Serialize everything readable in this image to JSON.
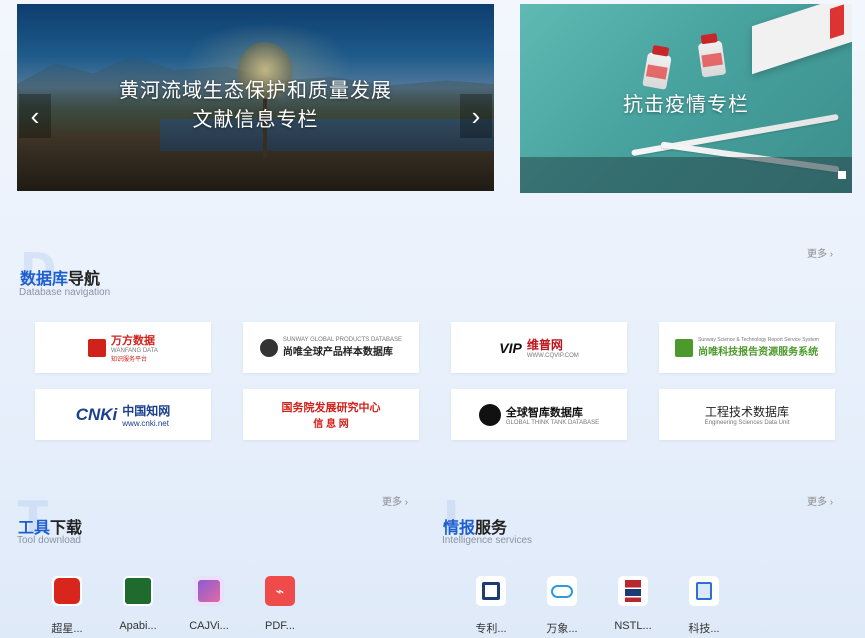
{
  "banners": {
    "left": {
      "title_line1": "黄河流域生态保护和质量发展",
      "title_line2": "文献信息专栏",
      "prev": "‹",
      "next": "›"
    },
    "right": {
      "title": "抗击疫情专栏"
    }
  },
  "database_nav": {
    "watermark": "D",
    "title_highlight": "数据库",
    "title_rest": "导航",
    "subtitle": "Database navigation",
    "more": "更多 ›",
    "items": [
      {
        "name": "万方数据",
        "sub1": "WANFANG DATA",
        "sub2": "知识服务平台",
        "color": "#d0221b"
      },
      {
        "name": "尚唯全球产品样本数据库",
        "sub1": "SUNWAY GLOBAL PRODUCTS DATABASE",
        "color": "#222222"
      },
      {
        "name": "维普网",
        "sub1": "WWW.CQVIP.COM",
        "prefix": "VIP",
        "color": "#c0141c"
      },
      {
        "name": "尚唯科技报告资源服务系统",
        "sub1": "Sunway Science & Technology Report Service System",
        "color": "#4d9a2c"
      },
      {
        "name": "中国知网",
        "sub1": "www.cnki.net",
        "prefix": "CNKi",
        "color": "#1b3f8f"
      },
      {
        "name": "国务院发展研究中心",
        "sub1": "信 息 网",
        "color": "#d0221b"
      },
      {
        "name": "全球智库数据库",
        "sub1": "GLOBAL THINK TANK DATABASE",
        "color": "#111111"
      },
      {
        "name": "工程技术数据库",
        "sub1": "Engineering Sciences Data Unit",
        "color": "#222222"
      }
    ]
  },
  "tool_download": {
    "watermark": "T",
    "title_highlight": "工具",
    "title_rest": "下载",
    "subtitle": "Tool download",
    "more": "更多 ›",
    "items": [
      {
        "label": "超星...",
        "icon": "chaoxing-icon",
        "color": "#d9261c"
      },
      {
        "label": "Apabi...",
        "icon": "apabi-icon",
        "color": "#1f6b2e"
      },
      {
        "label": "CAJVi...",
        "icon": "cajviewer-icon",
        "color": "#8b5cd6"
      },
      {
        "label": "PDF...",
        "icon": "pdf-icon",
        "color": "#f04b4b"
      }
    ]
  },
  "intelligence": {
    "watermark": "I",
    "title_highlight": "情报",
    "title_rest": "服务",
    "subtitle": "Intelligence services",
    "more": "更多 ›",
    "items": [
      {
        "label": "专利...",
        "icon": "patent-icon",
        "color": "#1d3b73"
      },
      {
        "label": "万象...",
        "icon": "cloud-icon",
        "color": "#2e9bd8"
      },
      {
        "label": "NSTL...",
        "icon": "nstl-icon",
        "color": "#b8272d"
      },
      {
        "label": "科技...",
        "icon": "document-icon",
        "color": "#2f6fd3"
      }
    ]
  }
}
